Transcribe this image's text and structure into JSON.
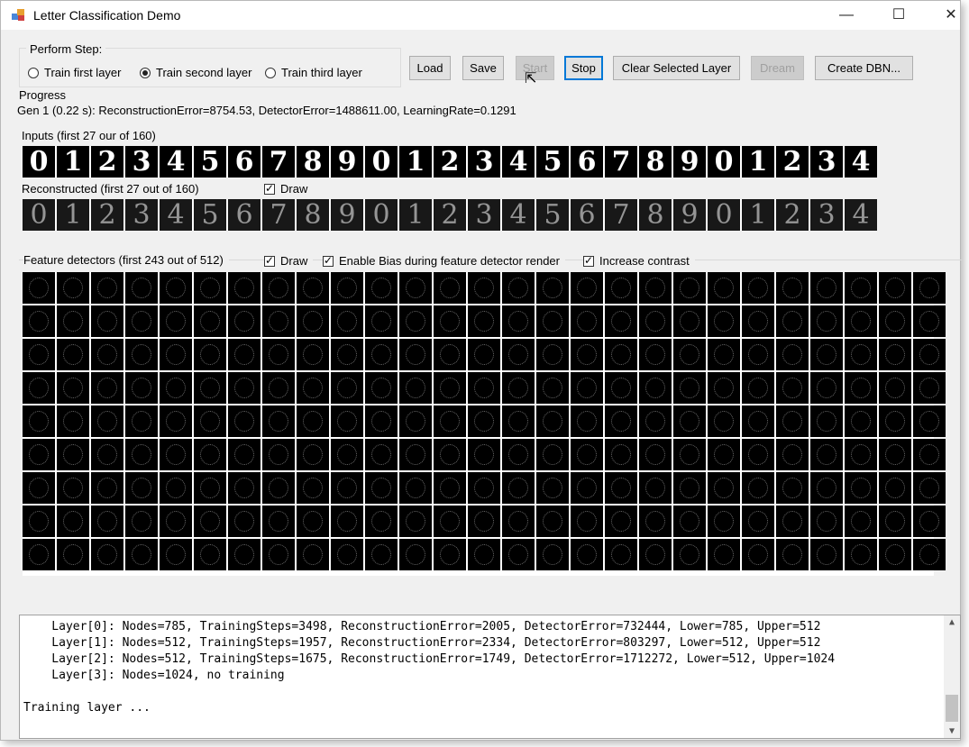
{
  "window": {
    "title": "Letter Classification Demo",
    "controls": {
      "minimize": "—",
      "maximize": "☐",
      "close": "✕"
    }
  },
  "perform_step": {
    "legend": "Perform Step:",
    "options": [
      {
        "label": "Train first layer",
        "selected": false
      },
      {
        "label": "Train second layer",
        "selected": true
      },
      {
        "label": "Train third layer",
        "selected": false
      }
    ]
  },
  "buttons": {
    "load": "Load",
    "save": "Save",
    "start": "Start",
    "stop": "Stop",
    "clear_selected_layer": "Clear Selected Layer",
    "dream": "Dream",
    "create_dbn": "Create DBN..."
  },
  "progress": {
    "label": "Progress",
    "text": "Gen 1 (0.22 s): ReconstructionError=8754.53, DetectorError=1488611.00, LearningRate=0.1291"
  },
  "inputs": {
    "label": "Inputs (first 27 our of 160)",
    "digits": [
      "0",
      "1",
      "2",
      "3",
      "4",
      "5",
      "6",
      "7",
      "8",
      "9",
      "0",
      "1",
      "2",
      "3",
      "4",
      "5",
      "6",
      "7",
      "8",
      "9",
      "0",
      "1",
      "2",
      "3",
      "4"
    ]
  },
  "reconstructed": {
    "label": "Reconstructed (first 27 out of 160)",
    "draw_label": "Draw",
    "draw_checked": true,
    "digits": [
      "0",
      "1",
      "2",
      "3",
      "4",
      "5",
      "6",
      "7",
      "8",
      "9",
      "0",
      "1",
      "2",
      "3",
      "4",
      "5",
      "6",
      "7",
      "8",
      "9",
      "0",
      "1",
      "2",
      "3",
      "4"
    ]
  },
  "feature_detectors": {
    "label": "Feature detectors (first 243 out of 512)",
    "draw_label": "Draw",
    "enable_bias_label": "Enable Bias during feature detector render",
    "increase_contrast_label": "Increase contrast",
    "draw_checked": true,
    "enable_bias_checked": true,
    "increase_contrast_checked": true,
    "columns": 27,
    "rows": 9
  },
  "log": {
    "lines": [
      "    Layer[0]: Nodes=785, TrainingSteps=3498, ReconstructionError=2005, DetectorError=732444, Lower=785, Upper=512",
      "    Layer[1]: Nodes=512, TrainingSteps=1957, ReconstructionError=2334, DetectorError=803297, Lower=512, Upper=512",
      "    Layer[2]: Nodes=512, TrainingSteps=1675, ReconstructionError=1749, DetectorError=1712272, Lower=512, Upper=1024",
      "    Layer[3]: Nodes=1024, no training",
      "",
      "Training layer ..."
    ]
  }
}
